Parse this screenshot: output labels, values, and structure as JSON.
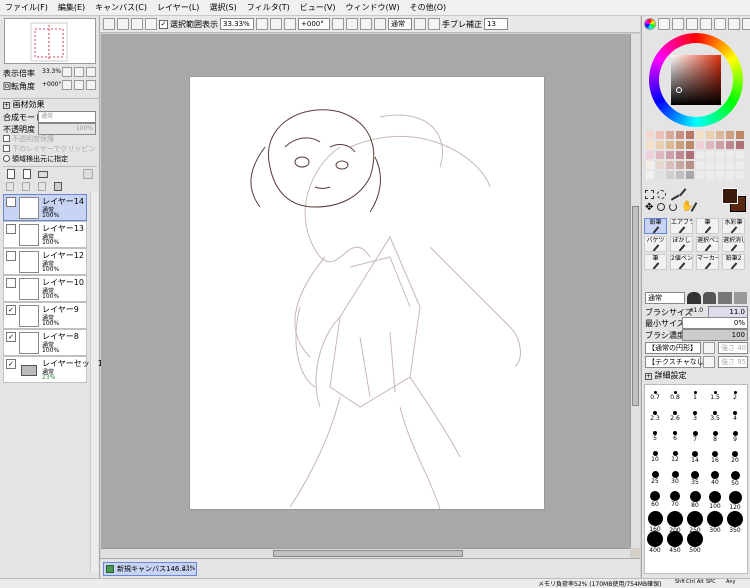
{
  "menu": [
    "ファイル(F)",
    "編集(E)",
    "キャンバス(C)",
    "レイヤー(L)",
    "選択(S)",
    "フィルタ(T)",
    "ビュー(V)",
    "ウィンドウ(W)",
    "その他(O)"
  ],
  "toolbar": {
    "selection_label": "選択範囲表示",
    "zoom": "33.33%",
    "rotation": "+000°",
    "mode": "通常",
    "stabilizer_label": "手ブレ補正",
    "stabilizer": "13"
  },
  "nav": {
    "zoom_label": "表示倍率",
    "zoom": "33.3%",
    "angle_label": "回転角度",
    "angle": "+000°"
  },
  "effects": {
    "title": "画材効果",
    "blend_label": "合成モード",
    "blend": "通常",
    "opacity_label": "不透明度",
    "opacity": "100%",
    "protect": "不透明度保護",
    "clipping": "下のレイヤーでクリッピング",
    "select_source": "領域検出元に指定"
  },
  "layers": [
    {
      "name": "レイヤー14",
      "mode": "通常",
      "opacity": "100%"
    },
    {
      "name": "レイヤー13",
      "mode": "通常",
      "opacity": "100%"
    },
    {
      "name": "レイヤー12",
      "mode": "通常",
      "opacity": "100%"
    },
    {
      "name": "レイヤー10",
      "mode": "通常",
      "opacity": "100%"
    },
    {
      "name": "レイヤー9",
      "mode": "通常",
      "opacity": "100%"
    },
    {
      "name": "レイヤー8",
      "mode": "通常",
      "opacity": "100%"
    },
    {
      "name": "レイヤーセット1",
      "mode": "通常",
      "opacity": "23%"
    }
  ],
  "tools": [
    "鉛筆",
    "エアブラシ",
    "筆",
    "水彩筆",
    "バケツ",
    "ぼかし",
    "選択ペン",
    "選択消し",
    "筆",
    "2値ペン",
    "マーカー",
    "鉛筆2"
  ],
  "brush": {
    "mode": "通常",
    "size_label": "ブラシサイズ",
    "size_mult": "x1.0",
    "size": "11.0",
    "min_label": "最小サイズ",
    "min": "0%",
    "density_label": "ブラシ濃度",
    "density": "100",
    "shape": "【通常の円形】",
    "texture": "【テクスチャなし】",
    "strength1": "強さ 40",
    "strength2": "強さ 95",
    "detail": "詳細設定"
  },
  "brush_sizes": [
    "0.7",
    "0.8",
    "1",
    "1.5",
    "2",
    "2.3",
    "2.6",
    "3",
    "3.5",
    "4",
    "5",
    "6",
    "7",
    "8",
    "9",
    "10",
    "12",
    "14",
    "16",
    "20",
    "25",
    "30",
    "35",
    "40",
    "50",
    "60",
    "70",
    "80",
    "100",
    "120",
    "160",
    "200",
    "250",
    "300",
    "350",
    "400",
    "450",
    "500"
  ],
  "taskbar": {
    "tab": "新規キャンバス146.s...",
    "zoom": "33%"
  },
  "status": {
    "memory": "メモリ負荷率52% (170MB使用/754MB確保)",
    "keys": [
      "Shft",
      "Ctrl",
      "Alt",
      "SPC"
    ],
    "any": "Any"
  },
  "colors": {
    "accent": "#6a86d8",
    "fg": "#3a1a0c",
    "bg": "#5a2810"
  }
}
